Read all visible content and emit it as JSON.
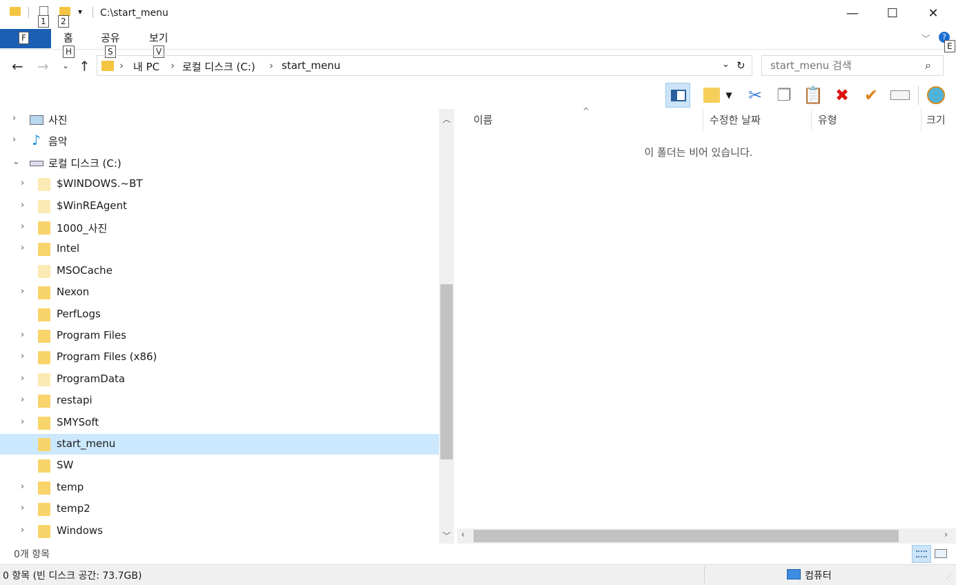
{
  "window": {
    "title": "C:\\start_menu",
    "quick_access_keytips": [
      "1",
      "2"
    ],
    "controls": {
      "minimize": "—",
      "maximize": "☐",
      "close": "✕"
    }
  },
  "ribbon": {
    "file_tab_keytip": "F",
    "tabs": [
      {
        "label": "홈",
        "keytip": "H"
      },
      {
        "label": "공유",
        "keytip": "S"
      },
      {
        "label": "보기",
        "keytip": "V"
      }
    ],
    "help_keytip": "E"
  },
  "address": {
    "crumbs": [
      "내 PC",
      "로컬 디스크 (C:)",
      "start_menu"
    ]
  },
  "search": {
    "placeholder": "start_menu 검색"
  },
  "tree": {
    "items": [
      {
        "label": "사진",
        "icon": "pictures-icon",
        "expandable": true,
        "expanded": false,
        "level": 0
      },
      {
        "label": "음악",
        "icon": "music-icon",
        "expandable": true,
        "expanded": false,
        "level": 0
      },
      {
        "label": "로컬 디스크 (C:)",
        "icon": "drive-icon",
        "expandable": true,
        "expanded": true,
        "level": 0
      },
      {
        "label": "$WINDOWS.~BT",
        "icon": "folder-icon",
        "expandable": true,
        "pale": true,
        "level": 1
      },
      {
        "label": "$WinREAgent",
        "icon": "folder-icon",
        "expandable": true,
        "pale": true,
        "level": 1
      },
      {
        "label": "1000_사진",
        "icon": "folder-icon",
        "expandable": true,
        "level": 1
      },
      {
        "label": "Intel",
        "icon": "folder-icon",
        "expandable": true,
        "level": 1
      },
      {
        "label": "MSOCache",
        "icon": "folder-icon",
        "expandable": false,
        "pale": true,
        "level": 1
      },
      {
        "label": "Nexon",
        "icon": "folder-icon",
        "expandable": true,
        "level": 1
      },
      {
        "label": "PerfLogs",
        "icon": "folder-icon",
        "expandable": false,
        "level": 1
      },
      {
        "label": "Program Files",
        "icon": "folder-icon",
        "expandable": true,
        "level": 1
      },
      {
        "label": "Program Files (x86)",
        "icon": "folder-icon",
        "expandable": true,
        "level": 1
      },
      {
        "label": "ProgramData",
        "icon": "folder-icon",
        "expandable": true,
        "pale": true,
        "level": 1
      },
      {
        "label": "restapi",
        "icon": "folder-icon",
        "expandable": true,
        "level": 1
      },
      {
        "label": "SMYSoft",
        "icon": "folder-icon",
        "expandable": true,
        "level": 1
      },
      {
        "label": "start_menu",
        "icon": "folder-icon",
        "expandable": false,
        "selected": true,
        "level": 1
      },
      {
        "label": "SW",
        "icon": "folder-icon",
        "expandable": false,
        "level": 1
      },
      {
        "label": "temp",
        "icon": "folder-icon",
        "expandable": true,
        "level": 1
      },
      {
        "label": "temp2",
        "icon": "folder-icon",
        "expandable": true,
        "level": 1
      },
      {
        "label": "Windows",
        "icon": "folder-icon",
        "expandable": true,
        "level": 1
      }
    ]
  },
  "content": {
    "columns": [
      "이름",
      "수정한 날짜",
      "유형",
      "크기"
    ],
    "empty_message": "이 폴더는 비어 있습니다."
  },
  "status": {
    "item_count": "0개 항목",
    "bottom_left": "0 항목 (빈 디스크 공간: 73.7GB)",
    "bottom_right": "컴퓨터"
  },
  "colors": {
    "selection": "#cce8ff",
    "file_tab": "#1a5fb4",
    "folder": "#f8d46a"
  }
}
